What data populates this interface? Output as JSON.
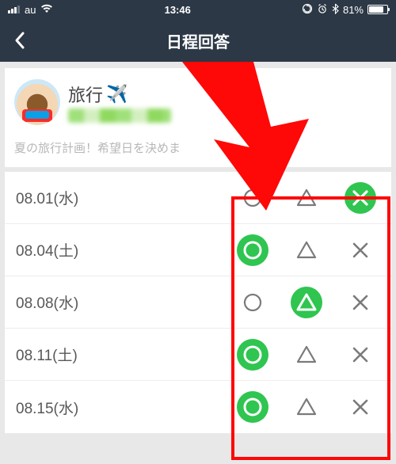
{
  "status": {
    "carrier": "au",
    "time": "13:46",
    "battery_pct": "81%"
  },
  "nav": {
    "title": "日程回答"
  },
  "event": {
    "title": "旅行",
    "subtitle": "夏の旅行計画！希望日を決めま"
  },
  "choice_icons": {
    "yes": "circle",
    "maybe": "triangle",
    "no": "cross"
  },
  "rows": [
    {
      "date": "08.01(水)",
      "selected": "no"
    },
    {
      "date": "08.04(土)",
      "selected": "yes"
    },
    {
      "date": "08.08(水)",
      "selected": "maybe"
    },
    {
      "date": "08.11(土)",
      "selected": "yes"
    },
    {
      "date": "08.15(水)",
      "selected": "yes"
    }
  ],
  "colors": {
    "accent": "#2fc550",
    "annotation": "#ff0808",
    "navbg": "#2c3846"
  }
}
